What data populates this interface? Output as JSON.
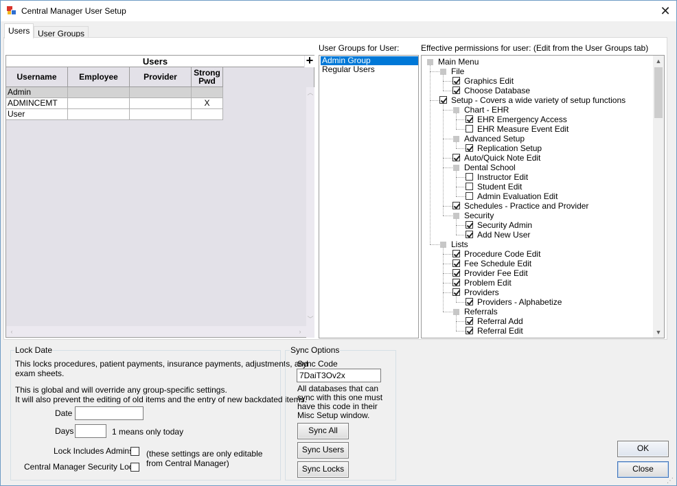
{
  "window": {
    "title": "Central Manager User Setup"
  },
  "tabs": [
    {
      "label": "Users",
      "active": true
    },
    {
      "label": "User Groups",
      "active": false
    }
  ],
  "users_grid": {
    "title": "Users",
    "add_button": "+",
    "columns": [
      "Username",
      "Employee",
      "Provider",
      "Strong Pwd"
    ],
    "rows": [
      {
        "username": "Admin",
        "employee": "",
        "provider": "",
        "strong_pwd": "",
        "selected": true
      },
      {
        "username": "ADMINCEMT",
        "employee": "",
        "provider": "",
        "strong_pwd": "X",
        "selected": false
      },
      {
        "username": "User",
        "employee": "",
        "provider": "",
        "strong_pwd": "",
        "selected": false
      }
    ]
  },
  "user_groups": {
    "label": "User Groups for User:",
    "items": [
      {
        "label": "Admin Group",
        "selected": true
      },
      {
        "label": "Regular Users",
        "selected": false
      }
    ]
  },
  "permissions": {
    "label": "Effective permissions for user: (Edit from the User Groups tab)",
    "nodes": [
      {
        "label": "Main Menu",
        "level": 0,
        "state": "indeterminate"
      },
      {
        "label": "File",
        "level": 1,
        "state": "indeterminate"
      },
      {
        "label": "Graphics Edit",
        "level": 2,
        "state": "checked"
      },
      {
        "label": "Choose Database",
        "level": 2,
        "state": "checked"
      },
      {
        "label": "Setup - Covers a wide variety of setup functions",
        "level": 1,
        "state": "checked"
      },
      {
        "label": "Chart - EHR",
        "level": 2,
        "state": "indeterminate"
      },
      {
        "label": "EHR Emergency Access",
        "level": 3,
        "state": "checked"
      },
      {
        "label": "EHR Measure Event Edit",
        "level": 3,
        "state": "unchecked"
      },
      {
        "label": "Advanced Setup",
        "level": 2,
        "state": "indeterminate"
      },
      {
        "label": "Replication Setup",
        "level": 3,
        "state": "checked"
      },
      {
        "label": "Auto/Quick Note Edit",
        "level": 2,
        "state": "checked"
      },
      {
        "label": "Dental School",
        "level": 2,
        "state": "indeterminate"
      },
      {
        "label": "Instructor Edit",
        "level": 3,
        "state": "unchecked"
      },
      {
        "label": "Student Edit",
        "level": 3,
        "state": "unchecked"
      },
      {
        "label": "Admin Evaluation Edit",
        "level": 3,
        "state": "unchecked"
      },
      {
        "label": "Schedules - Practice and Provider",
        "level": 2,
        "state": "checked"
      },
      {
        "label": "Security",
        "level": 2,
        "state": "indeterminate"
      },
      {
        "label": "Security Admin",
        "level": 3,
        "state": "checked"
      },
      {
        "label": "Add New User",
        "level": 3,
        "state": "checked"
      },
      {
        "label": "Lists",
        "level": 1,
        "state": "indeterminate"
      },
      {
        "label": "Procedure Code Edit",
        "level": 2,
        "state": "checked"
      },
      {
        "label": "Fee Schedule Edit",
        "level": 2,
        "state": "checked"
      },
      {
        "label": "Provider Fee Edit",
        "level": 2,
        "state": "checked"
      },
      {
        "label": "Problem Edit",
        "level": 2,
        "state": "checked"
      },
      {
        "label": "Providers",
        "level": 2,
        "state": "checked"
      },
      {
        "label": "Providers - Alphabetize",
        "level": 3,
        "state": "checked"
      },
      {
        "label": "Referrals",
        "level": 2,
        "state": "indeterminate"
      },
      {
        "label": "Referral Add",
        "level": 3,
        "state": "checked"
      },
      {
        "label": "Referral Edit",
        "level": 3,
        "state": "checked"
      }
    ]
  },
  "lock_date": {
    "title": "Lock Date",
    "desc1": "This locks procedures, patient payments, insurance payments, adjustments, and",
    "desc1b": "exam sheets.",
    "desc2": "This is global and will override any group-specific settings.",
    "desc3": "It will also prevent the editing of old items and the entry of new backdated items.",
    "date_label": "Date",
    "date_value": "",
    "days_label": "Days",
    "days_value": "",
    "days_hint": "1 means only today",
    "lock_admins_label": "Lock Includes Admins",
    "security_lock_label": "Central Manager Security Lock",
    "note1": "(these settings are only editable",
    "note2": "from Central Manager)"
  },
  "sync": {
    "title": "Sync Options",
    "code_label": "Sync Code",
    "code_value": "7DaiT3Ov2x",
    "desc": [
      "All databases that can",
      "sync with this one must",
      "have this code in their",
      "Misc Setup window."
    ],
    "sync_all": "Sync All",
    "sync_users": "Sync Users",
    "sync_locks": "Sync Locks"
  },
  "buttons": {
    "ok": "OK",
    "close": "Close"
  },
  "icons": {
    "close": "close-icon",
    "add": "plus-icon"
  }
}
